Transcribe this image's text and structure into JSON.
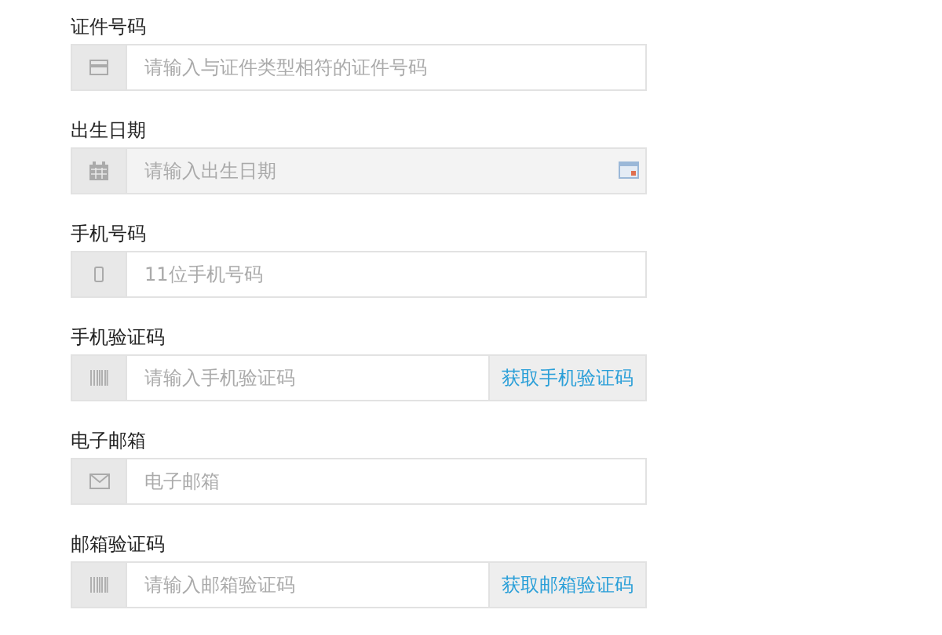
{
  "fields": [
    {
      "kind": "id",
      "label": "证件号码",
      "placeholder": "请输入与证件类型相符的证件号码",
      "readonly": false
    },
    {
      "kind": "date",
      "label": "出生日期",
      "placeholder": "请输入出生日期",
      "readonly": true
    },
    {
      "kind": "phone",
      "label": "手机号码",
      "placeholder": "11位手机号码",
      "readonly": false
    },
    {
      "kind": "code",
      "label": "手机验证码",
      "placeholder": "请输入手机验证码",
      "readonly": false,
      "action": "获取手机验证码"
    },
    {
      "kind": "email",
      "label": "电子邮箱",
      "placeholder": "电子邮箱",
      "readonly": false
    },
    {
      "kind": "code",
      "label": "邮箱验证码",
      "placeholder": "请输入邮箱验证码",
      "readonly": false,
      "action": "获取邮箱验证码"
    }
  ]
}
